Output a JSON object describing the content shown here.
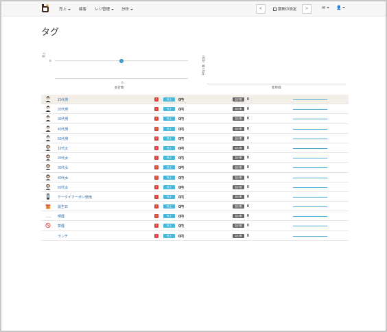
{
  "navbar": {
    "menu": [
      {
        "label": "売上",
        "dropdown": true
      },
      {
        "label": "顧客",
        "dropdown": false
      },
      {
        "label": "レジ管理",
        "dropdown": true
      },
      {
        "label": "分析",
        "dropdown": true
      }
    ],
    "prev_label": "<",
    "period_label": "期間の設定",
    "next_label": ">",
    "mail_icon": "envelope-icon",
    "user_icon": "user-icon"
  },
  "page": {
    "title": "タグ"
  },
  "chart_data": [
    {
      "type": "scatter",
      "ylabel": "売上",
      "xlabel": "会計数",
      "yticks": [
        "0"
      ],
      "xticks": [
        "0"
      ],
      "points": [
        {
          "x": 0,
          "y": 0
        }
      ]
    },
    {
      "type": "bar",
      "ylabel": "平均人数（会計）",
      "xlabel": "客単価",
      "values": []
    }
  ],
  "table": {
    "badge_red_text": "!",
    "badge_sales_text": "売上",
    "badge_count_text": "会計数",
    "rows": [
      {
        "icon": "man-icon",
        "name": "10代男",
        "sales": "0円",
        "count": "0"
      },
      {
        "icon": "man-icon",
        "name": "20代男",
        "sales": "0円",
        "count": "0"
      },
      {
        "icon": "man-icon",
        "name": "30代男",
        "sales": "0円",
        "count": "0"
      },
      {
        "icon": "man-icon",
        "name": "40代男",
        "sales": "0円",
        "count": "0"
      },
      {
        "icon": "man-icon",
        "name": "50代男",
        "sales": "0円",
        "count": "0"
      },
      {
        "icon": "woman-icon",
        "name": "10代女",
        "sales": "0円",
        "count": "0"
      },
      {
        "icon": "woman-icon",
        "name": "20代女",
        "sales": "0円",
        "count": "0"
      },
      {
        "icon": "woman-icon",
        "name": "30代女",
        "sales": "0円",
        "count": "0"
      },
      {
        "icon": "woman-icon",
        "name": "40代女",
        "sales": "0円",
        "count": "0"
      },
      {
        "icon": "woman-icon",
        "name": "50代女",
        "sales": "0円",
        "count": "0"
      },
      {
        "icon": "mobile-phone-icon",
        "name": "ケータイクーポン使用",
        "sales": "0円",
        "count": "0"
      },
      {
        "icon": "gift-icon",
        "name": "誕生日",
        "sales": "0円",
        "count": "0"
      },
      {
        "icon": "smoking-icon",
        "name": "喫煙",
        "sales": "0円",
        "count": "0"
      },
      {
        "icon": "no-smoking-icon",
        "name": "禁煙",
        "sales": "0円",
        "count": "0"
      },
      {
        "icon": "none",
        "name": "ランチ",
        "sales": "0円",
        "count": "0"
      }
    ]
  },
  "colors": {
    "accent": "#3ba6d6",
    "red": "#d9463b",
    "cyan": "#48b8d8",
    "gray": "#666666",
    "link": "#2f6ca8"
  }
}
